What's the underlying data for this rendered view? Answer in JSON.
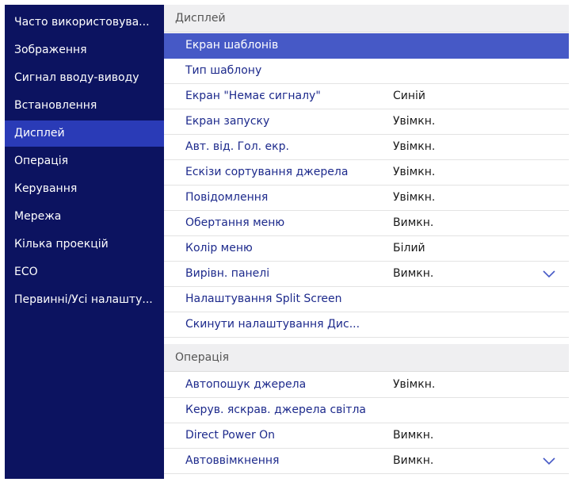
{
  "sidebar": {
    "items": [
      {
        "label": "Часто використовува..."
      },
      {
        "label": "Зображення"
      },
      {
        "label": "Сигнал вводу-виводу"
      },
      {
        "label": "Встановлення"
      },
      {
        "label": "Дисплей"
      },
      {
        "label": "Операція"
      },
      {
        "label": "Керування"
      },
      {
        "label": "Мережа"
      },
      {
        "label": "Кілька проекцій"
      },
      {
        "label": "ECO"
      },
      {
        "label": "Первинні/Усі налашту..."
      }
    ],
    "active_index": 4
  },
  "display_section": {
    "header": "Дисплей",
    "rows": [
      {
        "label": "Екран шаблонів",
        "value": ""
      },
      {
        "label": "Тип шаблону",
        "value": ""
      },
      {
        "label": "Екран \"Немає сигналу\"",
        "value": "Синій"
      },
      {
        "label": "Екран запуску",
        "value": "Увімкн."
      },
      {
        "label": "Авт. від. Гол. екр.",
        "value": "Увімкн."
      },
      {
        "label": "Ескізи сортування джерела",
        "value": "Увімкн."
      },
      {
        "label": "Повідомлення",
        "value": "Увімкн."
      },
      {
        "label": "Обертання меню",
        "value": "Вимкн."
      },
      {
        "label": "Колір меню",
        "value": "Білий"
      },
      {
        "label": "Вирівн. панелі",
        "value": "Вимкн."
      },
      {
        "label": "Налаштування Split Screen",
        "value": ""
      },
      {
        "label": "Скинути налаштування Дис...",
        "value": ""
      }
    ]
  },
  "operation_section": {
    "header": "Операція",
    "rows": [
      {
        "label": "Автопошук джерела",
        "value": "Увімкн."
      },
      {
        "label": "Керув. яскрав. джерела світла",
        "value": ""
      },
      {
        "label": "Direct Power On",
        "value": "Вимкн."
      },
      {
        "label": "Автоввімкнення",
        "value": "Вимкн."
      }
    ]
  },
  "icons": {
    "dropdown": "chevron-down-icon"
  },
  "colors": {
    "sidebar_bg": "#0c1360",
    "sidebar_active": "#2a3bb7",
    "row_selected": "#4659c6",
    "label_text": "#1d2a8c"
  }
}
